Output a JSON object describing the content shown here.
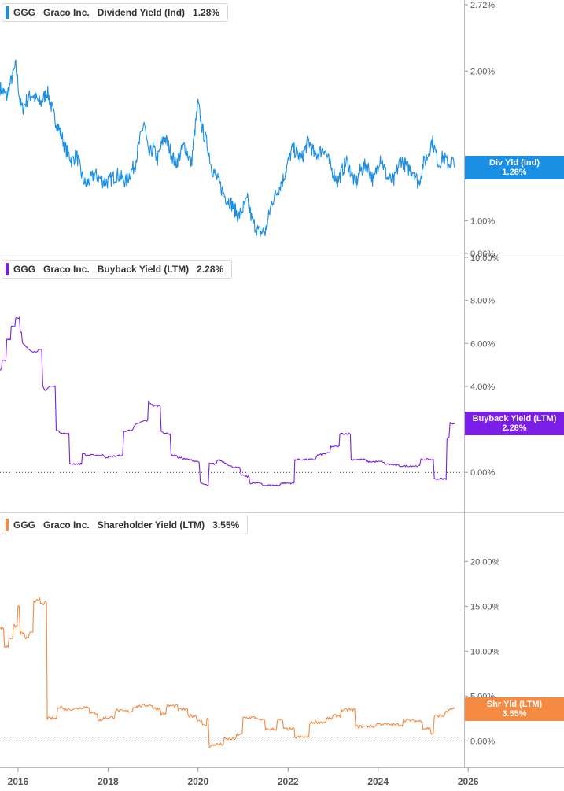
{
  "chart_data": [
    {
      "type": "line",
      "ticker": "GGG",
      "company": "Graco Inc.",
      "metric": "Dividend Yield (Ind)",
      "last_value": "1.28%",
      "tag_label": "Div Yld (Ind)",
      "color": "#1a8fe3",
      "scale": "log",
      "ylim": [
        0.86,
        2.72
      ],
      "yticks": [
        {
          "v": 2.72,
          "label": "2.72%"
        },
        {
          "v": 2.0,
          "label": "2.00%"
        },
        {
          "v": 1.0,
          "label": "1.00%"
        },
        {
          "v": 0.86,
          "label": "0.86%"
        }
      ],
      "zero_line": false,
      "series": [
        {
          "x": [
            2015.6,
            2015.75,
            2015.85,
            2015.95,
            2016.05,
            2016.1,
            2016.2,
            2016.3,
            2016.5,
            2016.65,
            2016.8,
            2016.95,
            2017.05,
            2017.2,
            2017.3,
            2017.4,
            2017.5,
            2017.7,
            2017.9,
            2018.0,
            2018.2,
            2018.4,
            2018.6,
            2018.8,
            2018.9,
            2019.0,
            2019.1,
            2019.25,
            2019.5,
            2019.7,
            2019.85,
            2020.0,
            2020.1,
            2020.2,
            2020.3,
            2020.45,
            2020.6,
            2020.75,
            2020.9,
            2021.1,
            2021.2,
            2021.35,
            2021.5,
            2021.65,
            2021.75,
            2021.9,
            2022.1,
            2022.3,
            2022.45,
            2022.6,
            2022.8,
            2022.95,
            2023.1,
            2023.3,
            2023.5,
            2023.6,
            2023.75,
            2023.9,
            2024.05,
            2024.2,
            2024.35,
            2024.5,
            2024.65,
            2024.8,
            2024.9,
            2025.0,
            2025.1,
            2025.2,
            2025.35,
            2025.45,
            2025.55,
            2025.65,
            2025.7
          ],
          "y": [
            1.85,
            1.78,
            1.92,
            2.05,
            1.72,
            1.68,
            1.75,
            1.8,
            1.72,
            1.82,
            1.62,
            1.5,
            1.4,
            1.32,
            1.36,
            1.25,
            1.18,
            1.24,
            1.2,
            1.2,
            1.24,
            1.2,
            1.3,
            1.58,
            1.35,
            1.4,
            1.33,
            1.48,
            1.3,
            1.42,
            1.3,
            1.72,
            1.52,
            1.43,
            1.28,
            1.2,
            1.12,
            1.08,
            1.02,
            1.1,
            1.0,
            0.95,
            0.95,
            1.1,
            1.14,
            1.22,
            1.4,
            1.33,
            1.45,
            1.35,
            1.4,
            1.28,
            1.2,
            1.32,
            1.18,
            1.26,
            1.3,
            1.2,
            1.35,
            1.22,
            1.2,
            1.33,
            1.28,
            1.26,
            1.18,
            1.3,
            1.35,
            1.45,
            1.3,
            1.35,
            1.3,
            1.32,
            1.28
          ]
        }
      ]
    },
    {
      "type": "line",
      "ticker": "GGG",
      "company": "Graco Inc.",
      "metric": "Buyback Yield (LTM)",
      "last_value": "2.28%",
      "tag_label": "Buyback Yield (LTM)",
      "color": "#7b1fe8",
      "scale": "linear",
      "ylim": [
        -1.2,
        10.0
      ],
      "yticks": [
        {
          "v": 10,
          "label": "10.00%"
        },
        {
          "v": 8,
          "label": "8.00%"
        },
        {
          "v": 6,
          "label": "6.00%"
        },
        {
          "v": 4,
          "label": "4.00%"
        },
        {
          "v": 0,
          "label": "0.00%"
        }
      ],
      "zero_line": true,
      "series": [
        {
          "x": [
            2015.6,
            2015.65,
            2015.75,
            2015.85,
            2015.95,
            2016.05,
            2016.1,
            2016.2,
            2016.35,
            2016.5,
            2016.55,
            2016.6,
            2016.7,
            2016.8,
            2016.85,
            2016.9,
            2017.05,
            2017.15,
            2017.3,
            2017.45,
            2017.5,
            2017.9,
            2017.95,
            2018.3,
            2018.35,
            2018.55,
            2018.6,
            2018.8,
            2018.9,
            2019.0,
            2019.2,
            2019.3,
            2019.4,
            2019.5,
            2019.55,
            2020.0,
            2020.05,
            2020.2,
            2020.25,
            2020.4,
            2020.45,
            2020.65,
            2020.7,
            2020.9,
            2020.95,
            2021.1,
            2021.15,
            2021.4,
            2021.45,
            2021.8,
            2021.85,
            2022.1,
            2022.15,
            2022.6,
            2022.65,
            2022.9,
            2022.95,
            2023.1,
            2023.15,
            2023.35,
            2023.4,
            2023.7,
            2023.75,
            2024.1,
            2024.15,
            2024.5,
            2024.55,
            2024.9,
            2024.95,
            2025.2,
            2025.25,
            2025.3,
            2025.55,
            2025.6,
            2025.7
          ],
          "y": [
            4.8,
            5.2,
            6.2,
            6.8,
            7.2,
            6.5,
            6.0,
            5.8,
            5.6,
            5.7,
            4.0,
            3.8,
            4.0,
            4.0,
            2.0,
            1.9,
            1.8,
            0.4,
            0.4,
            0.9,
            0.8,
            0.8,
            0.7,
            0.8,
            1.9,
            2.0,
            2.2,
            2.4,
            3.3,
            3.1,
            1.9,
            1.8,
            0.8,
            0.8,
            0.7,
            0.5,
            -0.5,
            -0.6,
            0.4,
            0.4,
            0.6,
            0.4,
            0.3,
            0.2,
            -0.1,
            -0.2,
            -0.5,
            -0.5,
            -0.6,
            -0.6,
            -0.5,
            -0.5,
            0.6,
            0.6,
            0.8,
            0.9,
            1.2,
            1.2,
            1.8,
            1.8,
            0.6,
            0.6,
            0.5,
            0.5,
            0.4,
            0.3,
            0.3,
            0.3,
            0.6,
            0.6,
            -0.3,
            -0.3,
            1.6,
            2.3,
            2.28
          ]
        }
      ]
    },
    {
      "type": "line",
      "ticker": "GGG",
      "company": "Graco Inc.",
      "metric": "Shareholder Yield (LTM)",
      "last_value": "3.55%",
      "tag_label": "Shr Yld (LTM)",
      "color": "#f58a42",
      "scale": "linear",
      "ylim": [
        -1.2,
        24.5
      ],
      "yticks": [
        {
          "v": 20,
          "label": "20.00%"
        },
        {
          "v": 15,
          "label": "15.00%"
        },
        {
          "v": 10,
          "label": "10.00%"
        },
        {
          "v": 5,
          "label": "5.00%"
        },
        {
          "v": 0,
          "label": "0.00%"
        }
      ],
      "zero_line": true,
      "series": [
        {
          "x": [
            2015.6,
            2015.7,
            2015.8,
            2015.9,
            2016.0,
            2016.05,
            2016.15,
            2016.25,
            2016.35,
            2016.4,
            2016.5,
            2016.6,
            2016.65,
            2016.7,
            2016.9,
            2017.0,
            2017.3,
            2017.5,
            2017.6,
            2017.8,
            2017.9,
            2018.2,
            2018.3,
            2018.6,
            2018.9,
            2019.0,
            2019.2,
            2019.3,
            2019.6,
            2019.8,
            2020.0,
            2020.1,
            2020.2,
            2020.25,
            2020.4,
            2020.6,
            2020.9,
            2021.0,
            2021.4,
            2021.5,
            2021.8,
            2021.9,
            2022.1,
            2022.15,
            2022.3,
            2022.5,
            2022.6,
            2022.9,
            2023.0,
            2023.2,
            2023.4,
            2023.5,
            2023.7,
            2024.0,
            2024.3,
            2024.6,
            2024.9,
            2025.0,
            2025.2,
            2025.25,
            2025.4,
            2025.5,
            2025.6,
            2025.7
          ],
          "y": [
            12.5,
            10.5,
            11.5,
            12.8,
            15.0,
            12.0,
            11.5,
            12.0,
            15.5,
            15.8,
            15.2,
            15.5,
            2.5,
            2.5,
            3.8,
            3.5,
            3.6,
            3.8,
            3.1,
            2.3,
            2.6,
            3.4,
            3.3,
            3.8,
            4.0,
            3.6,
            3.0,
            3.9,
            3.5,
            2.8,
            2.3,
            1.7,
            2.4,
            -0.6,
            -0.4,
            0.2,
            0.7,
            2.6,
            2.3,
            1.3,
            2.3,
            1.3,
            1.3,
            0.4,
            0.4,
            2.0,
            2.1,
            2.5,
            2.8,
            3.4,
            3.5,
            1.6,
            1.6,
            1.9,
            1.8,
            2.3,
            2.2,
            1.4,
            0.8,
            2.8,
            2.8,
            3.3,
            3.6,
            3.55
          ]
        }
      ]
    }
  ],
  "x_axis": {
    "ticks": [
      {
        "v": 2016,
        "label": "2016"
      },
      {
        "v": 2018,
        "label": "2018"
      },
      {
        "v": 2020,
        "label": "2020"
      },
      {
        "v": 2022,
        "label": "2022"
      },
      {
        "v": 2024,
        "label": "2024"
      },
      {
        "v": 2026,
        "label": "2026"
      }
    ]
  }
}
